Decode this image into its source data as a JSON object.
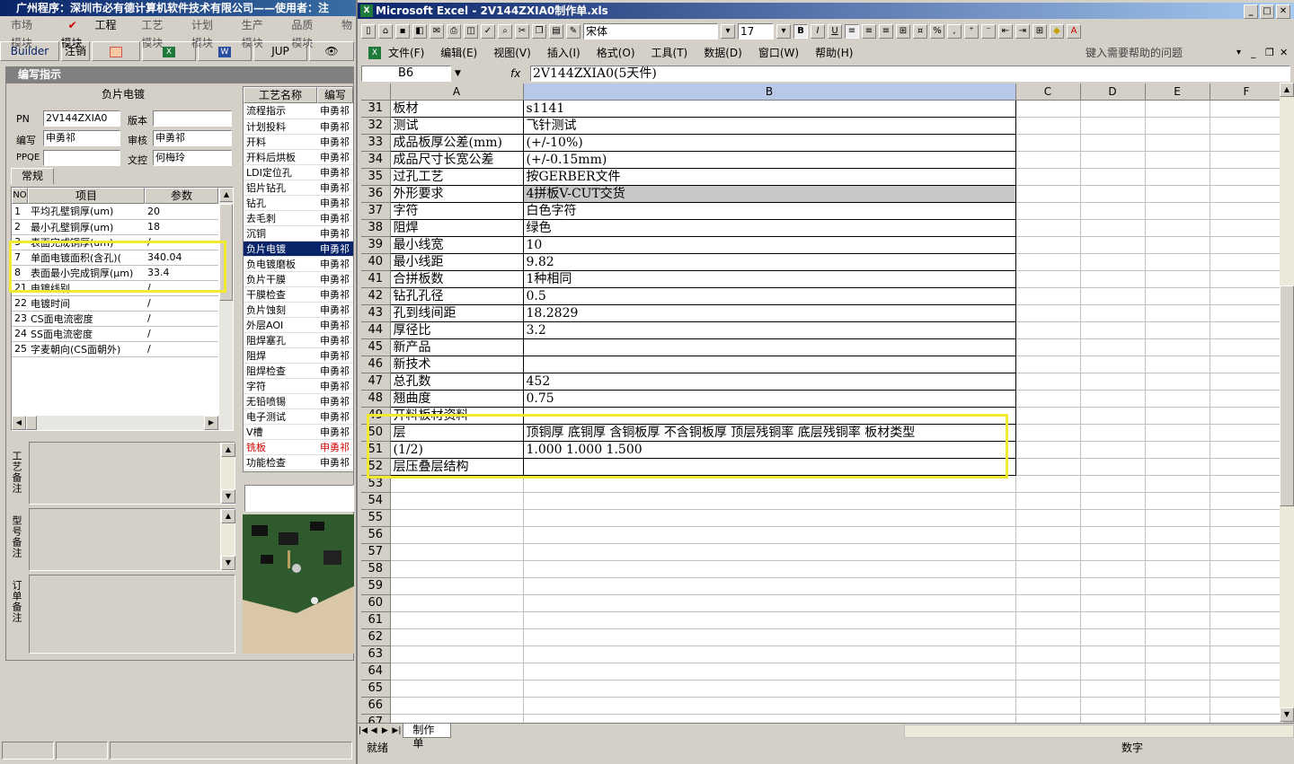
{
  "app": {
    "title": "广州程序：深圳市必有德计算机软件技术有限公司——使用者：注",
    "menu": [
      "市场模块",
      "工程模块",
      "工艺模块",
      "计划模块",
      "生产模块",
      "品质模块",
      "物"
    ],
    "toolbar": {
      "builder": "Builder",
      "logout": "注销",
      "jump": "JUP"
    },
    "panel_title": "编写指示",
    "section_title": "负片电镀",
    "fields": {
      "pn_label": "PN",
      "pn_value": "2V144ZXIA0",
      "version_label": "版本",
      "version_value": "",
      "editor_label": "编写",
      "editor_value": "申勇祁",
      "reviewer_label": "审核",
      "reviewer_value": "申勇祁",
      "ppqe_label": "PPQE",
      "ppqe_value": "",
      "doc_label": "文控",
      "doc_value": "何梅玲"
    },
    "tab_general": "常规",
    "params_headers": {
      "no": "NO",
      "item": "项目",
      "param": "参数"
    },
    "params": [
      {
        "no": "1",
        "item": "平均孔壁铜厚(um)",
        "value": "20"
      },
      {
        "no": "2",
        "item": "最小孔壁铜厚(um)",
        "value": "18"
      },
      {
        "no": "3",
        "item": "表面完成铜厚(um)",
        "value": "/"
      },
      {
        "no": "7",
        "item": "单面电镀面积(含孔)(",
        "value": "340.04"
      },
      {
        "no": "8",
        "item": "表面最小完成铜厚(μm)",
        "value": "33.4"
      },
      {
        "no": "21",
        "item": "电镀线别",
        "value": "/"
      },
      {
        "no": "22",
        "item": "电镀时间",
        "value": "/"
      },
      {
        "no": "23",
        "item": "CS面电流密度",
        "value": "/"
      },
      {
        "no": "24",
        "item": "SS面电流密度",
        "value": "/"
      },
      {
        "no": "25",
        "item": "字麦朝向(CS面朝外)",
        "value": "/"
      }
    ],
    "memo_labels": [
      "工艺备注",
      "型号备注",
      "订单备注"
    ],
    "process_headers": {
      "name": "工艺名称",
      "editor": "编写"
    },
    "processes": [
      {
        "name": "流程指示",
        "editor": "申勇祁"
      },
      {
        "name": "计划投料",
        "editor": "申勇祁"
      },
      {
        "name": "开料",
        "editor": "申勇祁"
      },
      {
        "name": "开料后烘板",
        "editor": "申勇祁"
      },
      {
        "name": "LDI定位孔",
        "editor": "申勇祁"
      },
      {
        "name": "铝片钻孔",
        "editor": "申勇祁"
      },
      {
        "name": "钻孔",
        "editor": "申勇祁"
      },
      {
        "name": "去毛刺",
        "editor": "申勇祁"
      },
      {
        "name": "沉铜",
        "editor": "申勇祁"
      },
      {
        "name": "负片电镀",
        "editor": "申勇祁"
      },
      {
        "name": "负电镀磨板",
        "editor": "申勇祁"
      },
      {
        "name": "负片干膜",
        "editor": "申勇祁"
      },
      {
        "name": "干膜检查",
        "editor": "申勇祁"
      },
      {
        "name": "负片蚀刻",
        "editor": "申勇祁"
      },
      {
        "name": "外层AOI",
        "editor": "申勇祁"
      },
      {
        "name": "阻焊塞孔",
        "editor": "申勇祁"
      },
      {
        "name": "阻焊",
        "editor": "申勇祁"
      },
      {
        "name": "阻焊检查",
        "editor": "申勇祁"
      },
      {
        "name": "字符",
        "editor": "申勇祁"
      },
      {
        "name": "无铅喷锡",
        "editor": "申勇祁"
      },
      {
        "name": "电子测试",
        "editor": "申勇祁"
      },
      {
        "name": "V槽",
        "editor": "申勇祁"
      },
      {
        "name": "铣板",
        "editor": "申勇祁"
      },
      {
        "name": "功能检查",
        "editor": "申勇祁"
      }
    ]
  },
  "excel": {
    "title": "Microsoft Excel - 2V144ZXIA0制作单.xls",
    "font_name": "宋体",
    "font_size": "17",
    "menu": [
      "文件(F)",
      "编辑(E)",
      "视图(V)",
      "插入(I)",
      "格式(O)",
      "工具(T)",
      "数据(D)",
      "窗口(W)",
      "帮助(H)"
    ],
    "help_placeholder": "键入需要帮助的问题",
    "name_box": "B6",
    "fx": "fx",
    "formula": "2V144ZXIA0(5天件)",
    "columns": [
      "A",
      "B",
      "C",
      "D",
      "E",
      "F"
    ],
    "rows": [
      {
        "n": "31",
        "a": "板材",
        "b": "s1141"
      },
      {
        "n": "32",
        "a": "测试",
        "b": "飞针测试"
      },
      {
        "n": "33",
        "a": "成品板厚公差(mm)",
        "b": "(+/-10%)"
      },
      {
        "n": "34",
        "a": "成品尺寸长宽公差",
        "b": "(+/-0.15mm)"
      },
      {
        "n": "35",
        "a": "过孔工艺",
        "b": "按GERBER文件"
      },
      {
        "n": "36",
        "a": "外形要求",
        "b": "4拼板V-CUT交货"
      },
      {
        "n": "37",
        "a": "字符",
        "b": "白色字符"
      },
      {
        "n": "38",
        "a": "阻焊",
        "b": "绿色"
      },
      {
        "n": "39",
        "a": "最小线宽",
        "b": "10"
      },
      {
        "n": "40",
        "a": "最小线距",
        "b": "9.82"
      },
      {
        "n": "41",
        "a": "合拼板数",
        "b": "1种相同"
      },
      {
        "n": "42",
        "a": "钻孔孔径",
        "b": "0.5"
      },
      {
        "n": "43",
        "a": "孔到线间距",
        "b": "18.2829"
      },
      {
        "n": "44",
        "a": "厚径比",
        "b": "3.2"
      },
      {
        "n": "45",
        "a": "新产品",
        "b": ""
      },
      {
        "n": "46",
        "a": "新技术",
        "b": ""
      },
      {
        "n": "47",
        "a": "总孔数",
        "b": "452"
      },
      {
        "n": "48",
        "a": "翘曲度",
        "b": "0.75"
      },
      {
        "n": "49",
        "a": "开料板材资料",
        "b": ""
      },
      {
        "n": "50",
        "a": "层",
        "b": "顶铜厚  底铜厚  含铜板厚  不含铜板厚  顶层残铜率  底层残铜率  板材类型"
      },
      {
        "n": "51",
        "a": "(1/2)",
        "b": "1.000   1.000    1.500"
      },
      {
        "n": "52",
        "a": "层压叠层结构",
        "b": ""
      },
      {
        "n": "53",
        "a": "",
        "b": ""
      },
      {
        "n": "54",
        "a": "",
        "b": ""
      },
      {
        "n": "55",
        "a": "",
        "b": ""
      },
      {
        "n": "56",
        "a": "",
        "b": ""
      },
      {
        "n": "57",
        "a": "",
        "b": ""
      },
      {
        "n": "58",
        "a": "",
        "b": ""
      },
      {
        "n": "59",
        "a": "",
        "b": ""
      },
      {
        "n": "60",
        "a": "",
        "b": ""
      },
      {
        "n": "61",
        "a": "",
        "b": ""
      },
      {
        "n": "62",
        "a": "",
        "b": ""
      },
      {
        "n": "63",
        "a": "",
        "b": ""
      },
      {
        "n": "64",
        "a": "",
        "b": ""
      },
      {
        "n": "65",
        "a": "",
        "b": ""
      },
      {
        "n": "66",
        "a": "",
        "b": ""
      },
      {
        "n": "67",
        "a": "",
        "b": ""
      }
    ],
    "sheet_tab": "制作单",
    "status_ready": "就绪",
    "status_num": "数字"
  },
  "colors": {
    "highlight": "#f2ea30",
    "selected_row": "#0a246a",
    "red_item": "#d40000"
  }
}
